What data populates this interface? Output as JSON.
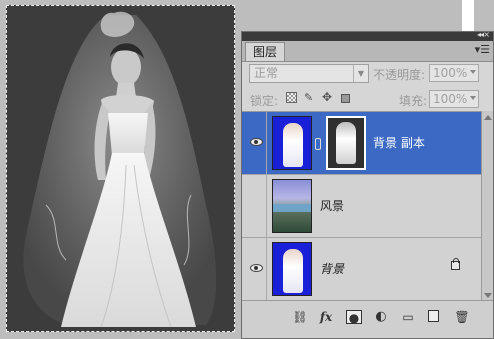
{
  "canvas": {
    "image": "bride-in-white-wedding-dress-grayscale",
    "background_color": "#3c3c3c"
  },
  "panel": {
    "tab_label": "图层",
    "menu_icon": "panel-menu-icon",
    "collapse_icon": "collapse-double-arrow-icon",
    "close_icon": "close-icon",
    "blend_mode": "正常",
    "opacity_label": "不透明度:",
    "opacity_value": "100%",
    "lock_label": "锁定:",
    "fill_label": "填充:",
    "fill_value": "100%",
    "lock_icons": [
      "lock-transparent-pixels-icon",
      "lock-image-pixels-icon",
      "lock-position-icon",
      "lock-all-icon"
    ],
    "layers": [
      {
        "name": "背景 副本",
        "selected": true,
        "thumbnail": "bride-on-blue",
        "mask": true,
        "linked": true
      },
      {
        "name": "风景",
        "selected": false,
        "thumbnail": "lake-mountain-scenery"
      },
      {
        "name": "背景",
        "selected": false,
        "thumbnail": "bride-on-blue",
        "locked": true,
        "italic": true
      }
    ],
    "footer_icons": [
      "link-layers-icon",
      "fx-icon",
      "add-mask-icon",
      "adjustment-layer-icon",
      "new-group-icon",
      "new-layer-icon",
      "delete-layer-icon"
    ],
    "fx_label": "fx",
    "selection_color": "#3b69c3"
  }
}
